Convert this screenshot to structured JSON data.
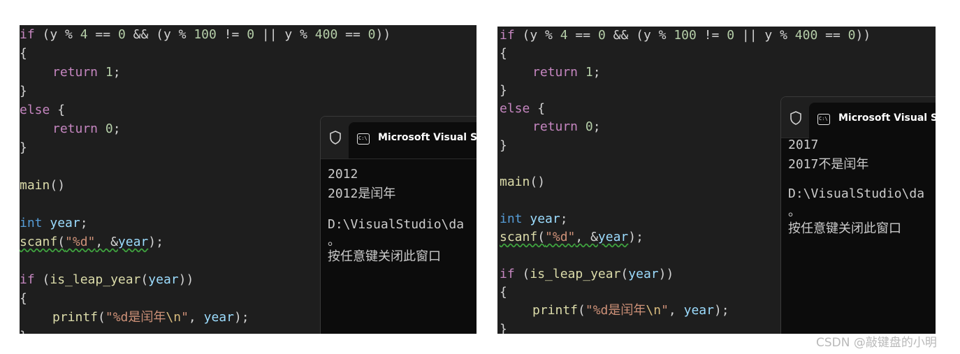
{
  "code": {
    "cond_kw": "if",
    "cond_open": " (y ",
    "cond_pct1": "%",
    "cond_sp1": " ",
    "cond_num4": "4",
    "cond_eq1": " == ",
    "cond_num0a": "0",
    "cond_and": " && (y ",
    "cond_pct2": "%",
    "cond_sp2": " ",
    "cond_num100": "100",
    "cond_ne": " != ",
    "cond_num0b": "0",
    "cond_or": " || y ",
    "cond_pct3": "%",
    "cond_sp3": " ",
    "cond_num400": "400",
    "cond_eq2": " == ",
    "cond_num0c": "0",
    "cond_close": "))",
    "brace_open": "{",
    "brace_close": "}",
    "return_kw": "return",
    "ret_one": "1",
    "ret_zero": "0",
    "semi": ";",
    "else_kw": "else",
    "else_brace": " {",
    "main_fn": "main",
    "main_parens": "()",
    "int_kw": "int",
    "year_var": "year",
    "scanf_fn": "scanf",
    "scanf_open": "(",
    "scanf_fmt": "\"%d\"",
    "scanf_comma": ", &",
    "scanf_close": ");",
    "if2_kw": "if",
    "if2_open": " (",
    "isleap_fn": "is_leap_year",
    "paren_open": "(",
    "if2_close": "))",
    "printf_fn": "printf",
    "printf_open": "(",
    "printf_str_a": "\"%d是闰年",
    "printf_esc": "\\n",
    "printf_str_b": "\"",
    "printf_comma": ", ",
    "printf_close": ");"
  },
  "console_title": "Microsoft Visual Studio",
  "left_console": {
    "input": "2012",
    "result": "2012是闰年",
    "path": "D:\\VisualStudio\\da",
    "period": "。",
    "prompt": "按任意键关闭此窗口"
  },
  "right_console": {
    "input": "2017",
    "result": "2017不是闰年",
    "path": "D:\\VisualStudio\\da",
    "period": "。",
    "prompt": "按任意键关闭此窗口"
  },
  "watermark": "CSDN @敲键盘的小明",
  "colors": {
    "editor_bg": "#1e1e1e",
    "console_bg": "#0c0c0c",
    "keyword_control": "#c586c0",
    "keyword_type": "#569cd6",
    "function": "#dcdcaa",
    "variable": "#9cdcfe",
    "number": "#b5cea8",
    "string": "#ce9178"
  }
}
